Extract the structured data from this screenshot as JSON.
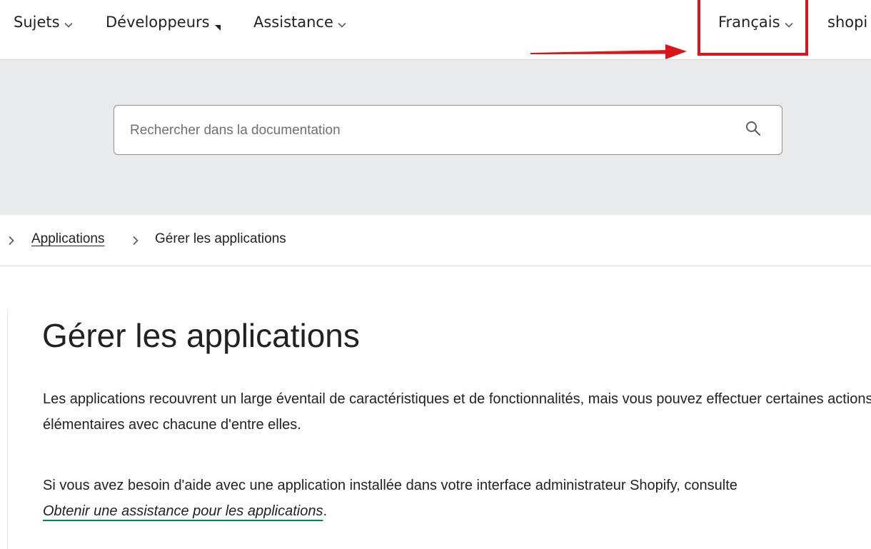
{
  "nav": {
    "items": [
      {
        "label": "Sujets",
        "icon": "chevron-down-icon"
      },
      {
        "label": "Développeurs",
        "icon": "external-link-icon"
      },
      {
        "label": "Assistance",
        "icon": "chevron-down-icon"
      }
    ],
    "language": {
      "label": "Français",
      "icon": "chevron-down-icon"
    },
    "shop_link_label": "shopi"
  },
  "annotation": {
    "highlight_color": "#d9141b"
  },
  "search": {
    "placeholder": "Rechercher dans la documentation",
    "value": "",
    "icon": "search-icon"
  },
  "breadcrumb": {
    "items": [
      {
        "label": "Applications",
        "link": true
      },
      {
        "label": "Gérer les applications",
        "link": false
      }
    ]
  },
  "article": {
    "title": "Gérer les applications",
    "paragraph1": "Les applications recouvrent un large éventail de caractéristiques et de fonctionnalités, mais vous pouvez effectuer certaines actions élémentaires avec chacune d'entre elles.",
    "paragraph2_text": "Si vous avez besoin d'aide avec une application installée dans votre interface administrateur Shopify, consulte",
    "paragraph2_link": "Obtenir une assistance pour les applications",
    "paragraph2_end": "."
  },
  "colors": {
    "link_underline": "#008060",
    "search_band": "#e9eaec"
  }
}
